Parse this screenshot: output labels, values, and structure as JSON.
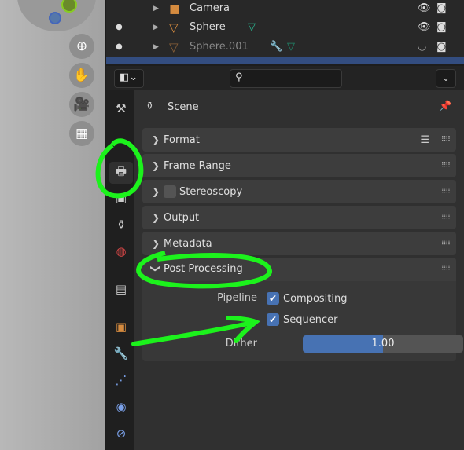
{
  "outliner": {
    "rows": [
      {
        "name": "Camera",
        "icon": "camera-icon",
        "visible": true
      },
      {
        "name": "Sphere",
        "icon": "mesh-icon",
        "visible": true
      },
      {
        "name": "Sphere.001",
        "icon": "mesh-icon",
        "visible": false
      }
    ]
  },
  "properties": {
    "context": "Scene",
    "panels": [
      {
        "label": "Format",
        "expanded": false
      },
      {
        "label": "Frame Range",
        "expanded": false
      },
      {
        "label": "Stereoscopy",
        "expanded": false
      },
      {
        "label": "Output",
        "expanded": false
      },
      {
        "label": "Metadata",
        "expanded": false
      },
      {
        "label": "Post Processing",
        "expanded": true
      }
    ],
    "post_processing": {
      "pipeline_label": "Pipeline",
      "compositing": {
        "label": "Compositing",
        "checked": true
      },
      "sequencer": {
        "label": "Sequencer",
        "checked": true
      },
      "dither": {
        "label": "Dither",
        "value": "1.00",
        "fill_fraction": 0.5
      }
    }
  },
  "colors": {
    "accent": "#4772b3",
    "annotation": "#1cf21c"
  }
}
